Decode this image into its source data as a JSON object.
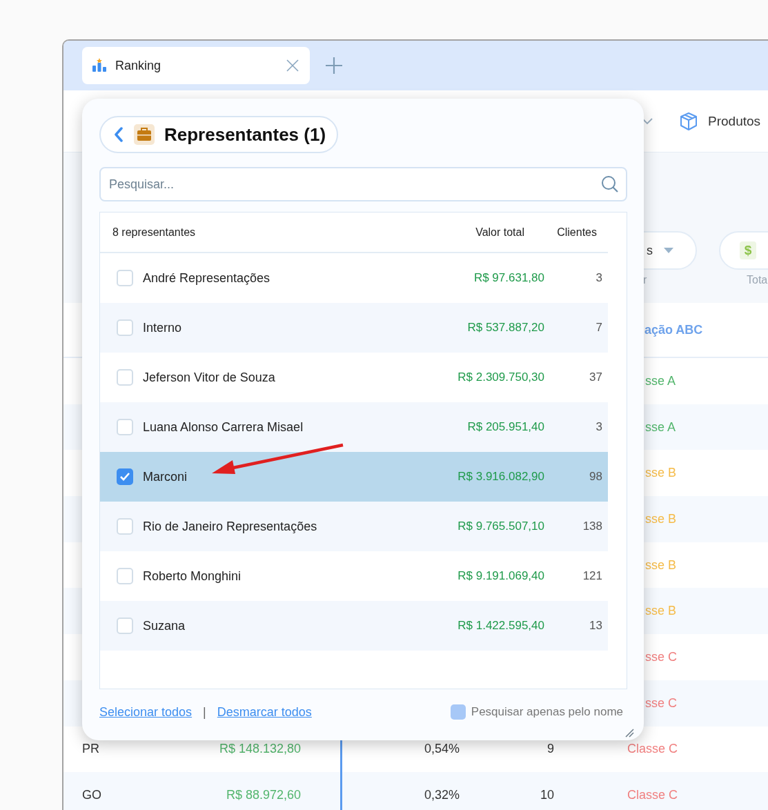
{
  "tab": {
    "label": "Ranking"
  },
  "toolbar": {
    "item_label": "Produtos"
  },
  "filters": [
    {
      "pill_text": "s",
      "caption": "r"
    },
    {
      "icon_text": "$",
      "caption": "Tota"
    }
  ],
  "table": {
    "class_header": "ação ABC",
    "rows": [
      {
        "kind": "covered",
        "class": "sse A",
        "color": "#52b56c"
      },
      {
        "kind": "covered",
        "class": "sse A",
        "color": "#52b56c"
      },
      {
        "kind": "covered",
        "class": "sse B",
        "color": "#f5bb48"
      },
      {
        "kind": "covered",
        "class": "sse B",
        "color": "#f5bb48"
      },
      {
        "kind": "covered",
        "class": "sse B",
        "color": "#f5bb48"
      },
      {
        "kind": "covered",
        "class": "sse B",
        "color": "#f5bb48"
      },
      {
        "kind": "covered",
        "class": "sse C",
        "color": "#f07f7f"
      },
      {
        "kind": "covered",
        "class": "sse C",
        "color": "#f07f7f"
      },
      {
        "kind": "full",
        "name": "PR",
        "value": "R$ 148.132,80",
        "share": "0,54%",
        "count": "9",
        "class": "Classe C",
        "color": "#f07f7f"
      },
      {
        "kind": "full",
        "name": "GO",
        "value": "R$ 88.972,60",
        "share": "0,32%",
        "count": "10",
        "class": "Classe C",
        "color": "#f07f7f"
      }
    ]
  },
  "popup": {
    "title": "Representantes (1)",
    "search": {
      "placeholder": "Pesquisar..."
    },
    "list_header": {
      "count": "8 representantes",
      "value": "Valor total",
      "clients": "Clientes"
    },
    "items": [
      {
        "name": "André Representações",
        "value": "R$ 97.631,80",
        "clients": "3",
        "selected": false
      },
      {
        "name": "Interno",
        "value": "R$ 537.887,20",
        "clients": "7",
        "selected": false
      },
      {
        "name": "Jeferson Vitor de Souza",
        "value": "R$ 2.309.750,30",
        "clients": "37",
        "selected": false
      },
      {
        "name": "Luana Alonso Carrera Misael",
        "value": "R$ 205.951,40",
        "clients": "3",
        "selected": false
      },
      {
        "name": "Marconi",
        "value": "R$ 3.916.082,90",
        "clients": "98",
        "selected": true
      },
      {
        "name": "Rio de Janeiro Representações",
        "value": "R$ 9.765.507,10",
        "clients": "138",
        "selected": false
      },
      {
        "name": "Roberto Monghini",
        "value": "R$ 9.191.069,40",
        "clients": "121",
        "selected": false
      },
      {
        "name": "Suzana",
        "value": "R$ 1.422.595,40",
        "clients": "13",
        "selected": false
      }
    ],
    "footer": {
      "select_all": "Selecionar todos",
      "separator": "|",
      "deselect_all": "Desmarcar todos",
      "name_only": {
        "label": "Pesquisar apenas pelo nome",
        "checked": false
      }
    }
  }
}
